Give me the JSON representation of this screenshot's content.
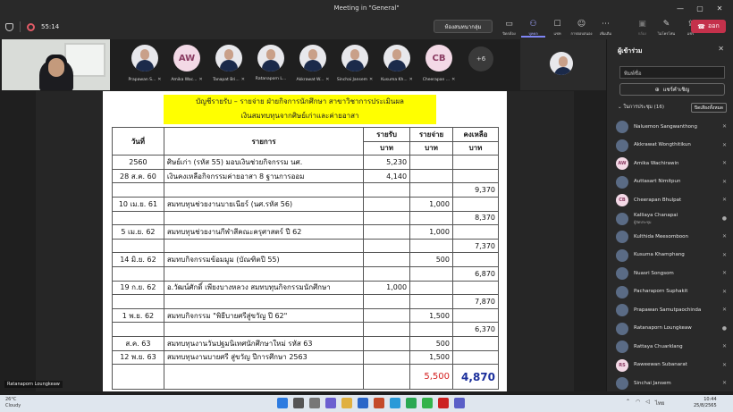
{
  "window": {
    "title": "Meeting in \"General\"",
    "controls": [
      "—",
      "▢",
      "✕"
    ]
  },
  "toolbar": {
    "timer": "55:14",
    "room_button": "ห้องสนทนากลุ่ม",
    "items": [
      {
        "label": "ปิดกล้อง",
        "icon": "camera-icon"
      },
      {
        "label": "บุคคล",
        "icon": "people-icon"
      },
      {
        "label": "แชท",
        "icon": "chat-icon"
      },
      {
        "label": "การตอบสนอง",
        "icon": "react-icon"
      },
      {
        "label": "เพิ่มเติม",
        "icon": "more-icon"
      },
      {
        "label": "กล้อง",
        "icon": "video-icon"
      },
      {
        "label": "ไมโครโฟน",
        "icon": "mic-icon"
      },
      {
        "label": "แชร์",
        "icon": "share-icon"
      }
    ],
    "leave_label": "ออก"
  },
  "gallery": {
    "tiles": [
      {
        "name": "Prapawan S...",
        "type": "photo"
      },
      {
        "name": "Amika Wac...",
        "type": "initials",
        "initials": "AW"
      },
      {
        "name": "Tanapat Bri...",
        "type": "photo"
      },
      {
        "name": "Ratanaporn L...",
        "type": "photo"
      },
      {
        "name": "Akkrawat W...",
        "type": "photo"
      },
      {
        "name": "Sinchai Jansem",
        "type": "photo"
      },
      {
        "name": "Kusuma Kh...",
        "type": "photo"
      },
      {
        "name": "Cheerapan ...",
        "type": "initials",
        "initials": "CB"
      }
    ],
    "more_count": "+6"
  },
  "document": {
    "heading1": "บัญชีรายรับ – รายจ่าย ฝ่ายกิจการนักศึกษา สาขาวิชาการประเมินผล",
    "heading2": "เงินสมทบทุนจากศิษย์เก่าและค่ายอาสา",
    "headers": {
      "date": "วันที่",
      "desc": "รายการ",
      "inc": "รายรับ",
      "exp": "รายจ่าย",
      "bal": "คงเหลือ",
      "unit": "บาท"
    },
    "rows": [
      {
        "date": "2560",
        "desc": "ศิษย์เก่า (รหัส 55) มอบเงินช่วยกิจกรรม นศ.",
        "inc": "5,230",
        "exp": "",
        "bal": ""
      },
      {
        "date": "28 ส.ค. 60",
        "desc": "เงินคงเหลือกิจกรรมค่ายอาสา 8 ฐานการออม",
        "inc": "4,140",
        "exp": "",
        "bal": ""
      },
      {
        "date": "",
        "desc": "",
        "inc": "",
        "exp": "",
        "bal": "9,370"
      },
      {
        "date": "10 เม.ย. 61",
        "desc": "สมทบทุนช่วยงานบายเนียร์ (นศ.รหัส 56)",
        "inc": "",
        "exp": "1,000",
        "bal": ""
      },
      {
        "date": "",
        "desc": "",
        "inc": "",
        "exp": "",
        "bal": "8,370"
      },
      {
        "date": "5 เม.ย. 62",
        "desc": "สมทบทุนช่วยงานกีฬาสีคณะครุศาสตร์ ปี 62",
        "inc": "",
        "exp": "1,000",
        "bal": ""
      },
      {
        "date": "",
        "desc": "",
        "inc": "",
        "exp": "",
        "bal": "7,370"
      },
      {
        "date": "14 มิ.ย. 62",
        "desc": "สมทบกิจกรรมข้อมมูม (บัณฑิตปี 55)",
        "inc": "",
        "exp": "500",
        "bal": ""
      },
      {
        "date": "",
        "desc": "",
        "inc": "",
        "exp": "",
        "bal": "6,870"
      },
      {
        "date": "19 ก.ย. 62",
        "desc": "อ.วัฒน์ศักดิ์ เพียงบางหลวง สมทบทุนกิจกรรมนักศึกษา",
        "inc": "1,000",
        "exp": "",
        "bal": ""
      },
      {
        "date": "",
        "desc": "",
        "inc": "",
        "exp": "",
        "bal": "7,870"
      },
      {
        "date": "1 พ.ย. 62",
        "desc": "สมทบกิจกรรม \"พิธีบายศรีสู่ขวัญ ปี 62\"",
        "inc": "",
        "exp": "1,500",
        "bal": ""
      },
      {
        "date": "",
        "desc": "",
        "inc": "",
        "exp": "",
        "bal": "6,370"
      },
      {
        "date": "ส.ค. 63",
        "desc": "สมทบทุนงานวันปฐมนิเทศนักศึกษาใหม่ รหัส 63",
        "inc": "",
        "exp": "500",
        "bal": ""
      },
      {
        "date": "12 พ.ย. 63",
        "desc": "สมทบทุนงานบายศรี สู่ขวัญ ปีการศึกษา 2563",
        "inc": "",
        "exp": "1,500",
        "bal": ""
      }
    ],
    "total_expense": "5,500",
    "total_balance": "4,870"
  },
  "presenter_label": "Ratanaporn Loungkeaw",
  "panel": {
    "title": "ผู้เข้าร่วม",
    "search_placeholder": "พิมพ์ชื่อ",
    "share_label": "แชร์คำเชิญ",
    "section_label": "ในการประชุม (16)",
    "mute_all": "ปิดเสียงทั้งหมด",
    "participants": [
      {
        "name": "Naluemon Sangwanthong",
        "type": "photo",
        "mic": "off"
      },
      {
        "name": "Akkrawat Wongthitikun",
        "type": "photo",
        "mic": "off"
      },
      {
        "name": "Amika Wachirawin",
        "type": "initials",
        "initials": "AW",
        "mic": "off"
      },
      {
        "name": "Auttasart Nimitpun",
        "type": "photo",
        "mic": "off"
      },
      {
        "name": "Cheerapan Bhulpat",
        "type": "initials",
        "initials": "CB",
        "mic": "off"
      },
      {
        "name": "Kalliaya Chanapai",
        "sub": "ผู้จัดประชุม",
        "type": "photo",
        "mic": "on"
      },
      {
        "name": "Kulthida Meesomboon",
        "type": "photo",
        "mic": "off"
      },
      {
        "name": "Kusuma Khamphang",
        "type": "photo",
        "mic": "off"
      },
      {
        "name": "Nuasri Songsom",
        "type": "photo",
        "mic": "off"
      },
      {
        "name": "Pacharaporn Suphakit",
        "type": "photo",
        "mic": "off"
      },
      {
        "name": "Prapawan Samutpaochinda",
        "type": "photo",
        "mic": "off"
      },
      {
        "name": "Ratanaporn Loungkeaw",
        "type": "photo",
        "mic": "on"
      },
      {
        "name": "Rattaya Chuarklang",
        "type": "photo",
        "mic": "off"
      },
      {
        "name": "Raweewan Subanarat",
        "type": "initials",
        "initials": "RS",
        "mic": "off"
      },
      {
        "name": "Sinchai Jansem",
        "type": "photo",
        "mic": "off"
      }
    ]
  },
  "taskbar": {
    "weather_temp": "26°C",
    "weather_desc": "Cloudy",
    "time": "10:44",
    "date": "25/8/2565",
    "lang": "ไทย"
  },
  "colors": {
    "leave": "#c4314b",
    "highlight": "#ffff00",
    "accent": "#7f85f5"
  }
}
